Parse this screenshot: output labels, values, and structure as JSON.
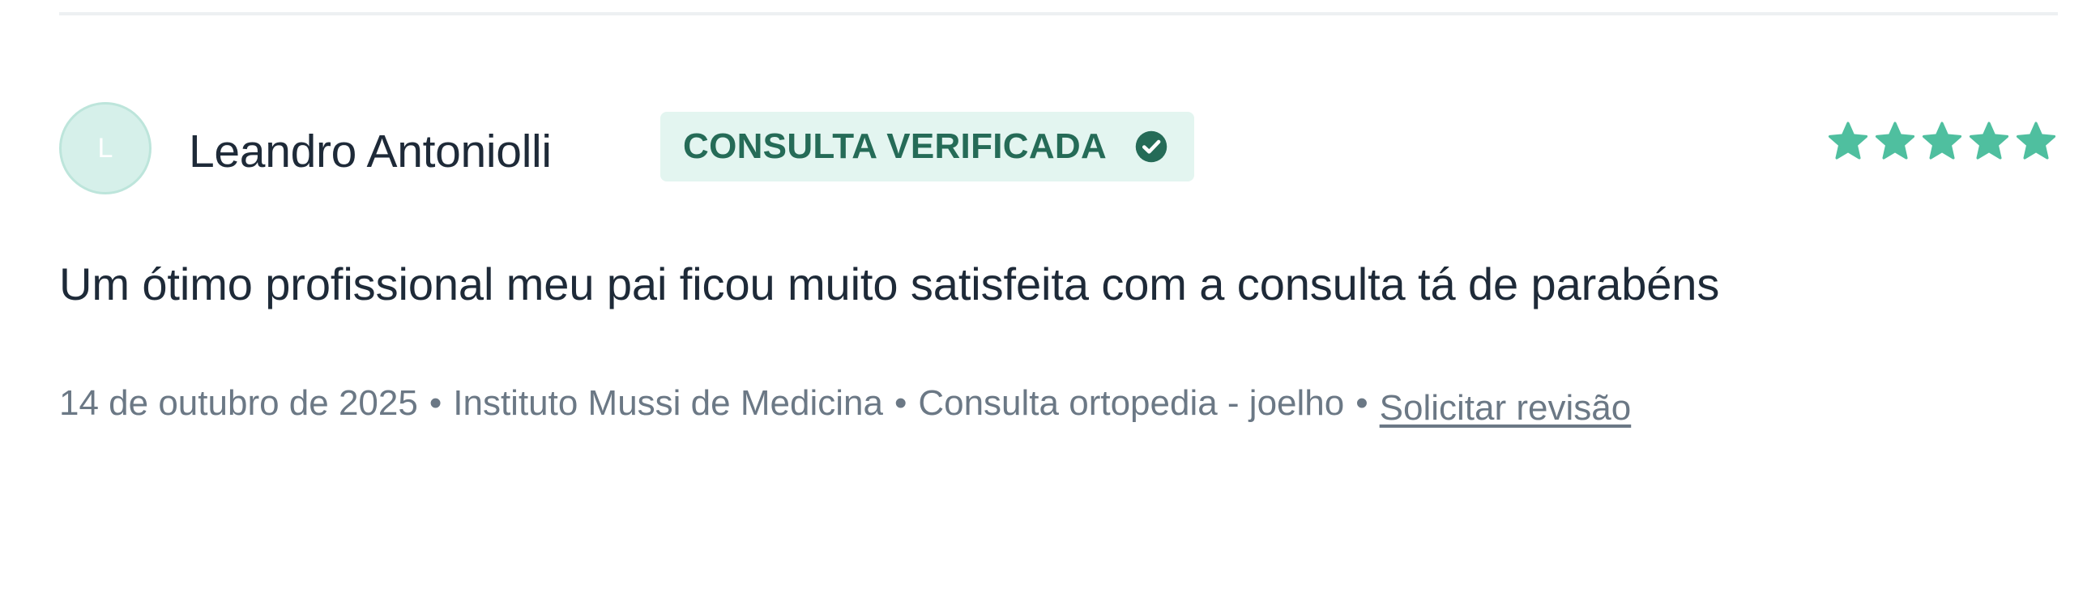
{
  "review": {
    "author": {
      "initial": "L",
      "name": "Leandro Antoniolli"
    },
    "badge": {
      "label": "CONSULTA VERIFICADA",
      "icon": "check-circle-icon"
    },
    "rating": {
      "value": 5,
      "max": 5,
      "icon": "star-icon",
      "color": "#4fbf9f"
    },
    "text": "Um ótimo profissional meu pai ficou muito satisfeita com a consulta tá de parabéns",
    "meta": {
      "date": "14 de outubro de 2025",
      "separator": "•",
      "location": "Instituto Mussi de Medicina",
      "service": "Consulta ortopedia - joelho",
      "action_label": "Solicitar revisão"
    }
  },
  "colors": {
    "accent": "#4fbf9f",
    "badge_background": "#e3f5f0",
    "badge_text": "#256b57",
    "avatar_background": "#d6f0ea",
    "muted_text": "#6b7885",
    "main_text": "#1e2a38"
  }
}
